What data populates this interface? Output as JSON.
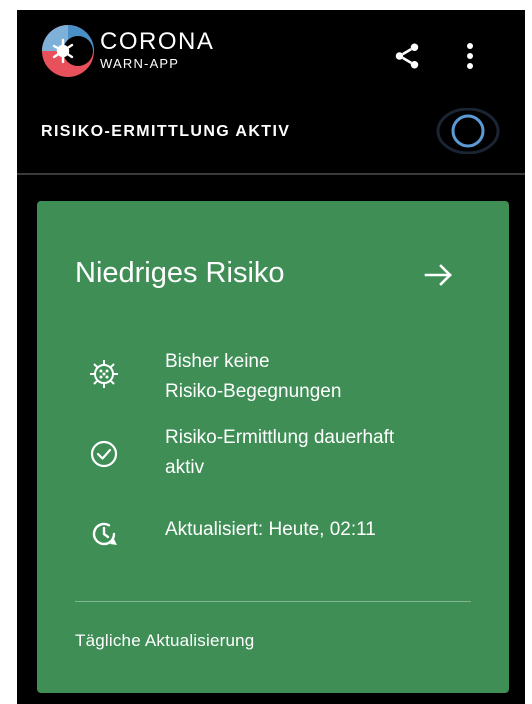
{
  "app": {
    "name": "CORONA",
    "subtitle": "WARN-APP"
  },
  "toolbar": {
    "share_icon": "share-icon",
    "more_icon": "more-vert-icon"
  },
  "status": {
    "label": "RISIKO-ERMITTLUNG AKTIV",
    "indicator_icon": "tracing-active-ring-icon"
  },
  "risk_card": {
    "title": "Niedriges Risiko",
    "arrow_icon": "arrow-right-icon",
    "rows": [
      {
        "icon": "virus-icon",
        "line1": "Bisher keine",
        "line2": "Risiko-Begegnungen"
      },
      {
        "icon": "check-circle-icon",
        "line1": "Risiko-Ermittlung dauerhaft",
        "line2": "aktiv"
      },
      {
        "icon": "clock-refresh-icon",
        "line1": "Aktualisiert: Heute, 02:11"
      }
    ],
    "footer": "Tägliche Aktualisierung"
  },
  "colors": {
    "background": "#000000",
    "card": "#3e8e56",
    "accent_blue": "#5b9bd5",
    "logo_red": "#e8505b"
  }
}
